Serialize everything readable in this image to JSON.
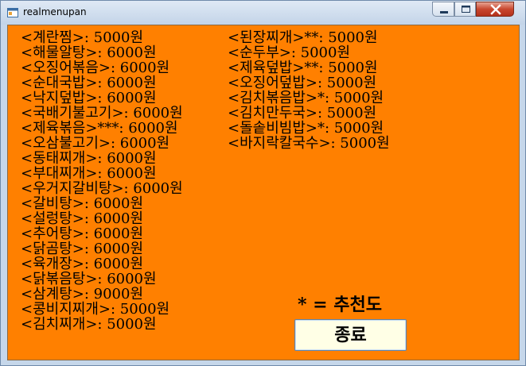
{
  "window": {
    "title": "realmenupan",
    "icon": "app-window-icon",
    "controls": [
      "minimize-icon",
      "maximize-icon",
      "close-icon"
    ]
  },
  "menu": {
    "left_column": [
      "<계란찜>: 5000원",
      "<해물알탕>: 6000원",
      "<오징어볶음>: 6000원",
      "<순대국밥>: 6000원",
      "<낙지덮밥>: 6000원",
      "<국배기불고기>: 6000원",
      "<제육볶음>***: 6000원",
      "<오삼불고기>: 6000원",
      "<동태찌개>: 6000원",
      "<부대찌개>: 6000원",
      "<우거지갈비탕>: 6000원",
      "<갈비탕>: 6000원",
      "<설렁탕>: 6000원",
      "<추어탕>: 6000원",
      "<닭곰탕>: 6000원",
      "<육개장>: 6000원",
      "<닭볶음탕>: 6000원",
      "<삼계탕>: 9000원",
      "<콩비지찌개>: 5000원",
      "<김치찌개>: 5000원"
    ],
    "right_column": [
      "<된장찌개>**: 5000원",
      "<순두부>: 5000원",
      "<제육덮밥>**: 5000원",
      "<오징어덮밥>: 5000원",
      "<김치볶음밥>*: 5000원",
      "<김치만두국>: 5000원",
      "<돌솥비빔밥>*: 5000원",
      "<바지락칼국수>: 5000원"
    ]
  },
  "legend": {
    "text": "* = 추천도"
  },
  "buttons": {
    "exit_label": "종료"
  },
  "colors": {
    "background": "#ff8000",
    "button_face": "#ffffe6",
    "title_bar": "#c6d7ea",
    "close_button": "#c8472f"
  }
}
